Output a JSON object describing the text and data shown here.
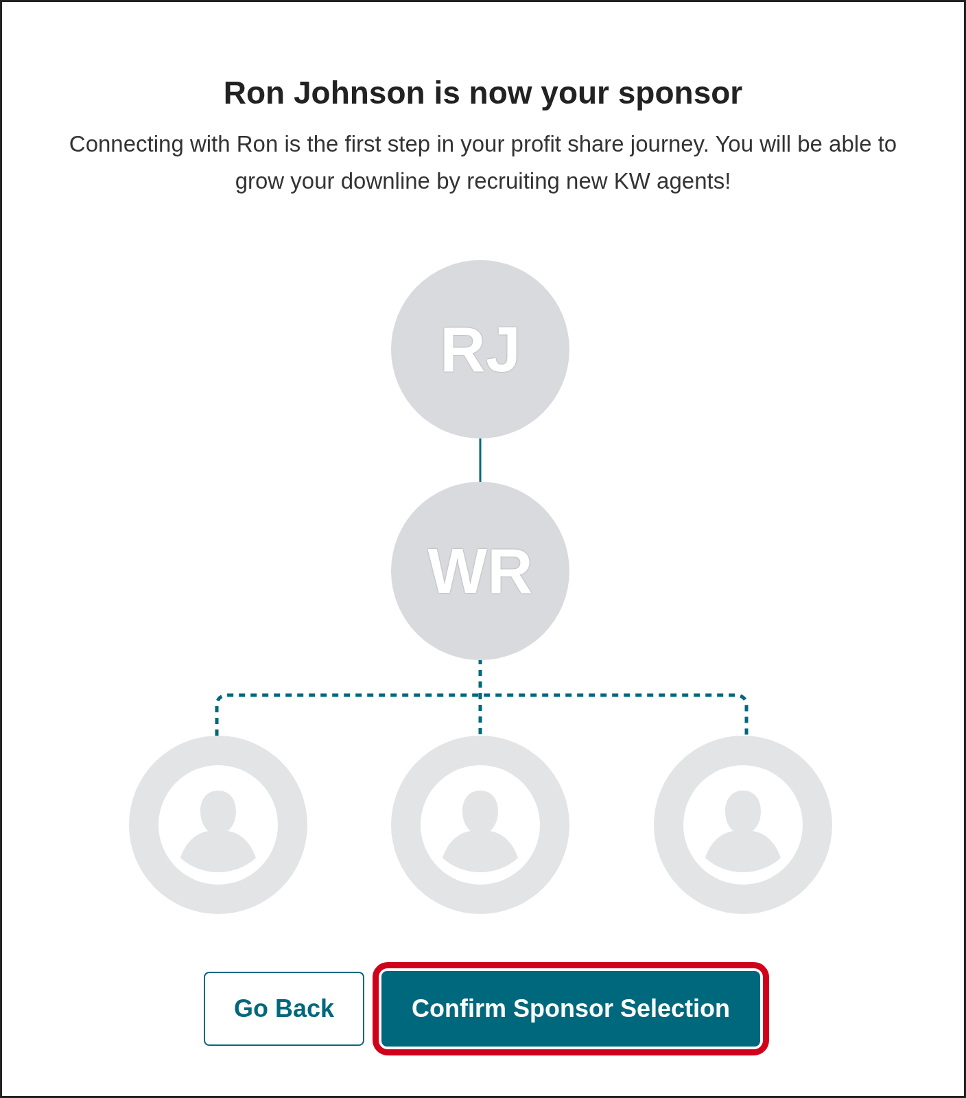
{
  "title": "Ron Johnson is now your sponsor",
  "description": "Connecting with Ron is the first step in your profit share journey. You will be able to grow your downline by recruiting new KW agents!",
  "tree": {
    "sponsor": {
      "initials": "RJ"
    },
    "you": {
      "initials": "WR"
    },
    "downline": [
      {
        "kind": "placeholder"
      },
      {
        "kind": "placeholder"
      },
      {
        "kind": "placeholder"
      }
    ]
  },
  "buttons": [
    {
      "label": "Go Back",
      "kind": "outline",
      "highlighted": false
    },
    {
      "label": "Confirm Sponsor Selection",
      "kind": "primary",
      "highlighted": true
    }
  ]
}
